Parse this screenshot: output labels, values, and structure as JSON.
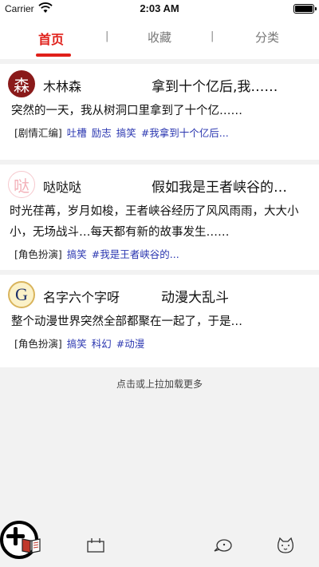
{
  "status_bar": {
    "carrier": "Carrier",
    "time": "2:03 AM"
  },
  "tabs": [
    {
      "label": "首页",
      "active": true
    },
    {
      "label": "收藏",
      "active": false
    },
    {
      "label": "分类",
      "active": false
    }
  ],
  "tab_separator": "|",
  "accent_color": "#e0201a",
  "link_color": "#2a36b0",
  "feed": [
    {
      "avatar_glyph": "森",
      "author": "木林森",
      "title": "拿到十个亿后,我……",
      "excerpt": "突然的一天，我从树洞口里拿到了十个亿……",
      "genre": "[剧情汇编]",
      "tags": [
        "吐槽",
        "励志",
        "搞笑",
        "#我拿到十个亿后..."
      ]
    },
    {
      "avatar_glyph": "哒",
      "author": "哒哒哒",
      "title": "假如我是王者峡谷的…",
      "excerpt": "时光荏苒，岁月如梭，王者峡谷经历了风风雨雨，大大小小，无场战斗…每天都有新的故事发生……",
      "genre": "[角色扮演]",
      "tags": [
        "搞笑",
        "#我是王者峡谷的..."
      ]
    },
    {
      "avatar_glyph": "G",
      "author": "名字六个字呀",
      "title": "动漫大乱斗",
      "excerpt": "整个动漫世界突然全部都聚在一起了，于是…",
      "genre": "[角色扮演]",
      "tags": [
        "搞笑",
        "科幻",
        "#动漫"
      ]
    }
  ],
  "load_more": "点击或上拉加载更多",
  "bottom_nav": [
    {
      "icon": "book-icon"
    },
    {
      "icon": "list-icon"
    },
    {
      "icon": "add-icon"
    },
    {
      "icon": "chat-icon"
    },
    {
      "icon": "profile-icon"
    }
  ]
}
